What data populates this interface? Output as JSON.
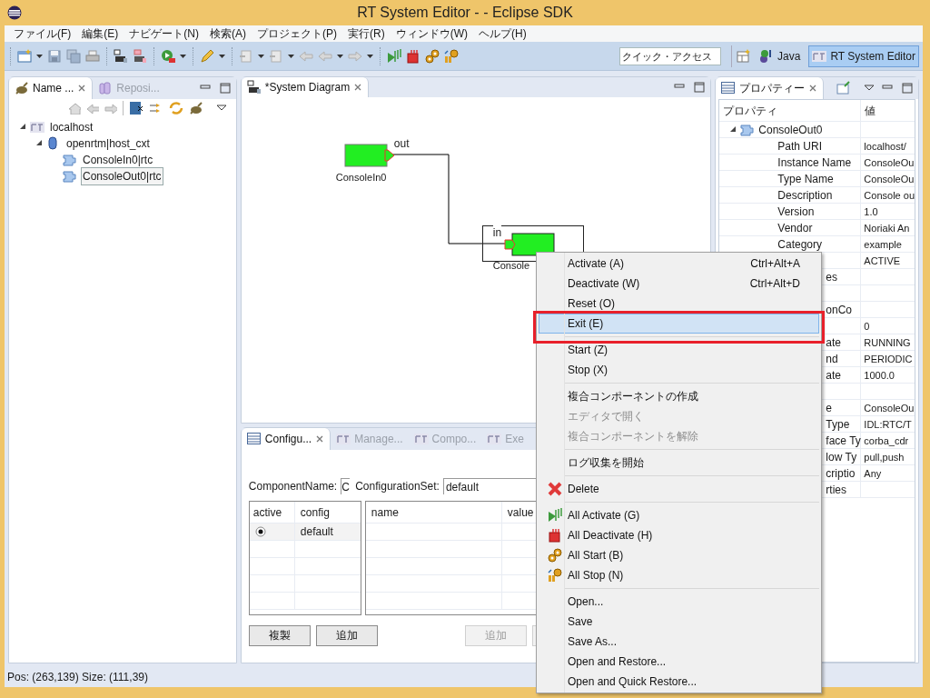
{
  "window": {
    "title": "RT System Editor -  - Eclipse SDK"
  },
  "menu_bar": [
    "ファイル(F)",
    "編集(E)",
    "ナビゲート(N)",
    "検索(A)",
    "プロジェクト(P)",
    "実行(R)",
    "ウィンドウ(W)",
    "ヘルプ(H)"
  ],
  "quick_access": {
    "placeholder": "クイック・アクセス"
  },
  "perspectives": [
    {
      "label": "Java",
      "selected": false
    },
    {
      "label": "RT System Editor",
      "selected": true
    }
  ],
  "left_panel": {
    "tabs": [
      {
        "label": "Name ...",
        "selected": true
      },
      {
        "label": "Reposi...",
        "selected": false
      }
    ],
    "tree": [
      {
        "label": "localhost",
        "kind": "host",
        "expanded": true,
        "selected": false,
        "children": [
          {
            "label": "openrtm|host_cxt",
            "kind": "context",
            "expanded": true,
            "selected": false,
            "children": [
              {
                "label": "ConsoleIn0|rtc",
                "kind": "component",
                "selected": false
              },
              {
                "label": "ConsoleOut0|rtc",
                "kind": "component",
                "selected": true
              }
            ]
          }
        ]
      }
    ]
  },
  "editor": {
    "tab": {
      "label": "*System Diagram",
      "selected": true
    },
    "components": [
      {
        "name": "ConsoleIn0",
        "port": "out",
        "selected": false
      },
      {
        "name": "Console",
        "port": "in",
        "selected": true
      }
    ]
  },
  "config_panel": {
    "tabs": [
      {
        "label": "Configu...",
        "selected": true
      },
      {
        "label": "Manage...",
        "selected": false
      },
      {
        "label": "Compo...",
        "selected": false
      },
      {
        "label": "Exe",
        "selected": false
      }
    ],
    "component_name_label": "ComponentName:",
    "component_name_value": "C",
    "configuration_set_label": "ConfigurationSet:",
    "configuration_set_value": "default",
    "sets_table": {
      "columns": [
        "active",
        "config"
      ],
      "rows": [
        {
          "active": true,
          "config": "default"
        }
      ]
    },
    "params_table": {
      "columns": [
        "name",
        "value"
      ]
    },
    "buttons": [
      {
        "label": "複製",
        "disabled": false
      },
      {
        "label": "追加",
        "disabled": false
      },
      {
        "label": "追加",
        "disabled": true
      }
    ]
  },
  "properties_panel": {
    "tab": "プロパティー",
    "columns": [
      "プロパティ",
      "値"
    ],
    "group": "ConsoleOut0",
    "rows": [
      {
        "kind": "full",
        "key": "Path URI",
        "value": "localhost/"
      },
      {
        "kind": "full",
        "key": "Instance Name",
        "value": "ConsoleOu"
      },
      {
        "kind": "full",
        "key": "Type Name",
        "value": "ConsoleOu"
      },
      {
        "kind": "full",
        "key": "Description",
        "value": "Console ou"
      },
      {
        "kind": "full",
        "key": "Version",
        "value": "1.0"
      },
      {
        "kind": "full",
        "key": "Vendor",
        "value": "Noriaki An"
      },
      {
        "kind": "full",
        "key": "Category",
        "value": "example"
      },
      {
        "kind": "cut",
        "value": "ACTIVE"
      },
      {
        "kind": "cut",
        "key": "es"
      },
      {
        "kind": "blank"
      },
      {
        "kind": "cut",
        "key": "onCo"
      },
      {
        "kind": "cut",
        "value": "0"
      },
      {
        "kind": "cut",
        "key": "ate",
        "value": "RUNNING"
      },
      {
        "kind": "cut",
        "key": "nd",
        "value": "PERIODIC"
      },
      {
        "kind": "cut",
        "key": "ate",
        "value": "1000.0"
      },
      {
        "kind": "blank"
      },
      {
        "kind": "cut",
        "key": "e",
        "value": "ConsoleOu"
      },
      {
        "kind": "cut",
        "key": "Type",
        "value": "IDL:RTC/T"
      },
      {
        "kind": "cut",
        "key": "face Ty",
        "value": "corba_cdr"
      },
      {
        "kind": "cut",
        "key": "low Ty",
        "value": "pull,push"
      },
      {
        "kind": "cut",
        "key": "criptio",
        "value": "Any"
      },
      {
        "kind": "cut",
        "key": "rties"
      }
    ]
  },
  "status_bar": "Pos: (263,139) Size: (111,39)",
  "context_menu": {
    "items": [
      {
        "kind": "item",
        "label": "Activate (A)",
        "shortcut": "Ctrl+Alt+A",
        "disabled": false,
        "selected": false
      },
      {
        "kind": "item",
        "label": "Deactivate (W)",
        "shortcut": "Ctrl+Alt+D",
        "disabled": false,
        "selected": false
      },
      {
        "kind": "item",
        "label": "Reset (O)",
        "disabled": false,
        "selected": false
      },
      {
        "kind": "item",
        "label": "Exit (E)",
        "disabled": false,
        "selected": true
      },
      {
        "kind": "separator"
      },
      {
        "kind": "item",
        "label": "Start (Z)",
        "disabled": false,
        "selected": false
      },
      {
        "kind": "item",
        "label": "Stop (X)",
        "disabled": false,
        "selected": false
      },
      {
        "kind": "separator"
      },
      {
        "kind": "item",
        "label": "複合コンポーネントの作成",
        "disabled": false,
        "selected": false
      },
      {
        "kind": "item",
        "label": "エディタで開く",
        "disabled": true,
        "selected": false
      },
      {
        "kind": "item",
        "label": "複合コンポーネントを解除",
        "disabled": true,
        "selected": false
      },
      {
        "kind": "separator"
      },
      {
        "kind": "item",
        "label": "ログ収集を開始",
        "disabled": false,
        "selected": false
      },
      {
        "kind": "separator"
      },
      {
        "kind": "delete",
        "label": "Delete",
        "disabled": false,
        "selected": false
      },
      {
        "kind": "separator"
      },
      {
        "kind": "activate",
        "label": "All Activate (G)",
        "disabled": false,
        "selected": false
      },
      {
        "kind": "deactivate",
        "label": "All Deactivate (H)",
        "disabled": false,
        "selected": false
      },
      {
        "kind": "start",
        "label": "All Start (B)",
        "disabled": false,
        "selected": false
      },
      {
        "kind": "stop",
        "label": "All Stop (N)",
        "disabled": false,
        "selected": false
      },
      {
        "kind": "separator"
      },
      {
        "kind": "item",
        "label": "Open...",
        "disabled": false,
        "selected": false
      },
      {
        "kind": "item",
        "label": "Save",
        "disabled": false,
        "selected": false
      },
      {
        "kind": "item",
        "label": "Save As...",
        "disabled": false,
        "selected": false
      },
      {
        "kind": "item",
        "label": "Open and Restore...",
        "disabled": false,
        "selected": false
      },
      {
        "kind": "item",
        "label": "Open and Quick Restore...",
        "disabled": false,
        "selected": false
      }
    ]
  }
}
